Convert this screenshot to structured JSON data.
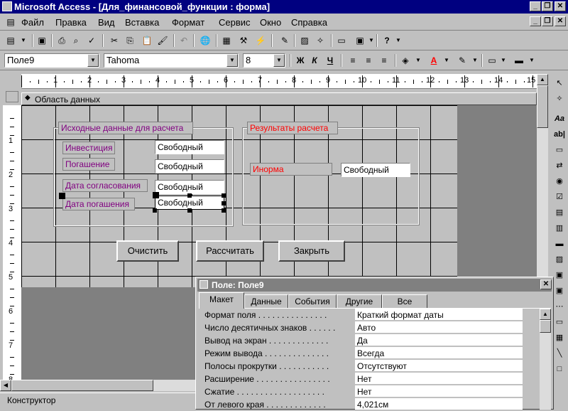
{
  "window": {
    "title": "Microsoft Access - [Для_финансовой_функции : форма]"
  },
  "menu": [
    "Файл",
    "Правка",
    "Вид",
    "Вставка",
    "Формат",
    "Сервис",
    "Окно",
    "Справка"
  ],
  "format_toolbar": {
    "object": "Поле9",
    "font": "Tahoma",
    "size": "8",
    "bold": "Ж",
    "italic": "К",
    "underline": "Ч"
  },
  "ruler": {
    "numbers": [
      "1",
      "2",
      "3",
      "4",
      "5",
      "6",
      "7",
      "8",
      "9",
      "10",
      "11",
      "12",
      "13",
      "14",
      "15"
    ],
    "vnumbers": [
      "1",
      "2",
      "3",
      "4",
      "5",
      "6",
      "7",
      "8"
    ]
  },
  "section": {
    "label": "Область данных"
  },
  "form": {
    "group1_title": "Исходные данные для расчета",
    "group2_title": "Результаты расчета",
    "labels": {
      "investment": "Инвестиция",
      "repayment": "Погашение",
      "agreement_date": "Дата согласования",
      "repayment_date": "Дата погашения",
      "inorma": "Инорма"
    },
    "fields": {
      "investment": "Свободный",
      "repayment": "Свободный",
      "agreement_date": "Свободный",
      "repayment_date": "Свободный",
      "inorma": "Свободный"
    },
    "buttons": {
      "clear": "Очистить",
      "calculate": "Рассчитать",
      "close": "Закрыть"
    }
  },
  "properties": {
    "title": "Поле: Поле9",
    "tabs": [
      "Макет",
      "Данные",
      "События",
      "Другие",
      "Все"
    ],
    "rows": [
      {
        "name": "Формат поля . . . . . . . . . . . . . . .",
        "value": "Краткий формат даты"
      },
      {
        "name": "Число десятичных знаков . . . . . .",
        "value": "Авто"
      },
      {
        "name": "Вывод на экран . . . . . . . . . . . . .",
        "value": "Да"
      },
      {
        "name": "Режим вывода . . . . . . . . . . . . . .",
        "value": "Всегда"
      },
      {
        "name": "Полосы прокрутки . . . . . . . . . . .",
        "value": "Отсутствуют"
      },
      {
        "name": "Расширение . . . . . . . . . . . . . . . .",
        "value": "Нет"
      },
      {
        "name": "Сжатие . . . . . . . . . . . . . . . . . . .",
        "value": "Нет"
      },
      {
        "name": "От левого края . . . . . . . . . . . . .",
        "value": "4,021см"
      }
    ]
  },
  "status": {
    "text": "Конструктор"
  },
  "colors": {
    "title_bg": "#000080",
    "red_label": "#ff0000",
    "label_text": "#800080"
  }
}
